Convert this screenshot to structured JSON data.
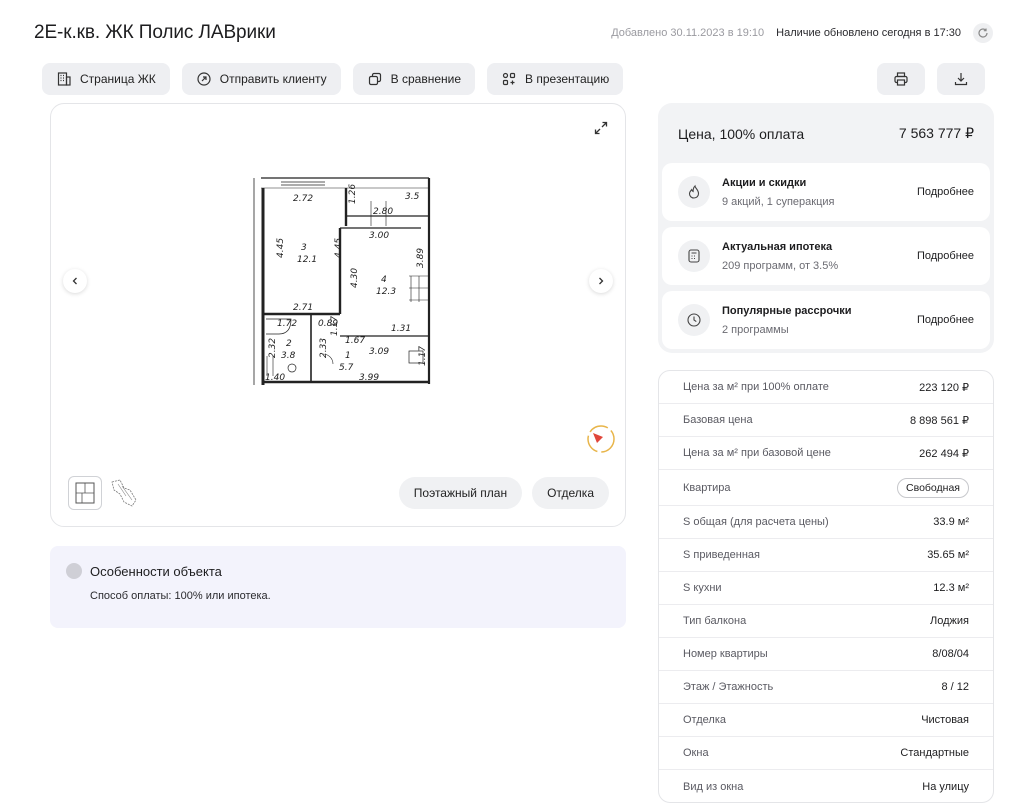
{
  "header": {
    "title": "2Е-к.кв. ЖК Полис ЛАВрики",
    "added": "Добавлено 30.11.2023 в 19:10",
    "updated": "Наличие обновлено сегодня в 17:30"
  },
  "toolbar": {
    "complex_page": "Страница ЖК",
    "send_client": "Отправить клиенту",
    "compare": "В сравнение",
    "presentation": "В презентацию"
  },
  "plan": {
    "floor_plan_label": "Поэтажный план",
    "finish_label": "Отделка",
    "dims": {
      "d272": "2.72",
      "d35": "3.5",
      "d126": "1.26",
      "d280": "2.80",
      "d300": "3.00",
      "d445a": "4.45",
      "r3": "3",
      "a121": "12.1",
      "d445b": "4.45",
      "r4": "4",
      "a123": "12.3",
      "d430": "4.30",
      "d389": "3.89",
      "d271": "2.71",
      "d172": "1.72",
      "d089": "0.89",
      "d131": "1.31",
      "r2": "2",
      "a38": "3.8",
      "d167": "1.67",
      "d309": "3.09",
      "r1": "1",
      "a57": "5.7",
      "d399": "3.99",
      "d140": "1.40",
      "d232": "2.32",
      "d233": "2.33",
      "d117a": "1.17",
      "d117b": "1.17"
    }
  },
  "features": {
    "title": "Особенности объекта",
    "text": "Способ оплаты: 100% или ипотека."
  },
  "price": {
    "label": "Цена, 100% оплата",
    "value": "7 563 777 ₽",
    "offers": [
      {
        "title": "Акции и скидки",
        "sub": "9 акций, 1 суперакция",
        "more": "Подробнее",
        "icon": "fire-icon"
      },
      {
        "title": "Актуальная ипотека",
        "sub": "209 программ, от 3.5%",
        "more": "Подробнее",
        "icon": "calculator-icon"
      },
      {
        "title": "Популярные рассрочки",
        "sub": "2 программы",
        "more": "Подробнее",
        "icon": "clock-icon"
      }
    ]
  },
  "details": [
    {
      "label": "Цена за м² при 100% оплате",
      "value": "223 120 ₽"
    },
    {
      "label": "Базовая цена",
      "value": "8 898 561 ₽"
    },
    {
      "label": "Цена за м² при базовой цене",
      "value": "262 494 ₽"
    },
    {
      "label": "Квартира",
      "value": "Свободная"
    },
    {
      "label": "S общая (для расчета цены)",
      "value": "33.9 м²"
    },
    {
      "label": "S приведенная",
      "value": "35.65 м²"
    },
    {
      "label": "S кухни",
      "value": "12.3 м²"
    },
    {
      "label": "Тип балкона",
      "value": "Лоджия"
    },
    {
      "label": "Номер квартиры",
      "value": "8/08/04"
    },
    {
      "label": "Этаж / Этажность",
      "value": "8 / 12"
    },
    {
      "label": "Отделка",
      "value": "Чистовая"
    },
    {
      "label": "Окна",
      "value": "Стандартные"
    },
    {
      "label": "Вид из окна",
      "value": "На улицу"
    }
  ],
  "colors": {
    "accent_red": "#e0463a",
    "compass_ring": "#e8b54a",
    "features_bg": "#f3f3fc"
  }
}
